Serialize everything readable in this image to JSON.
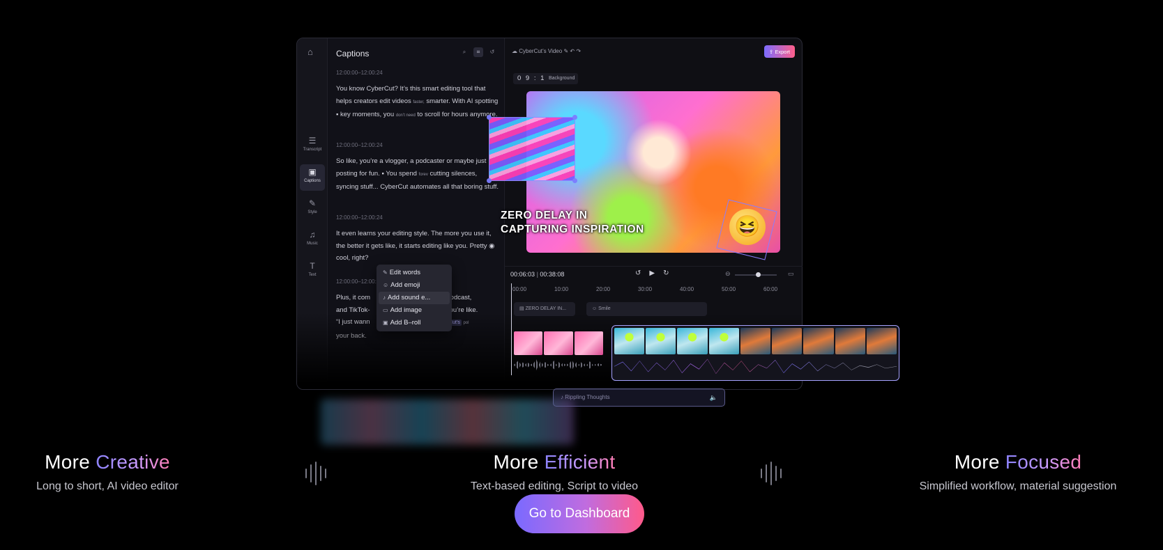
{
  "editor": {
    "captions_title": "Captions",
    "rail": {
      "transcript": "Transcript",
      "captions": "Captions",
      "style": "Style",
      "music": "Music",
      "text": "Text"
    },
    "segments": [
      {
        "time": "12:00:00–12:00:24"
      },
      {
        "time": "12:00:00–12:00:24"
      },
      {
        "time": "12:00:00–12:00:24"
      },
      {
        "time": "12:00:00–12:00:24"
      }
    ],
    "seg1": {
      "a": "You know CyberCut? It’s this smart editing tool that helps creators edit videos",
      "small1": "faster,",
      "b": "smarter. With AI spotting",
      "c": "key moments, you",
      "small2": "don’t need",
      "d": "to scroll for hours anymore."
    },
    "seg2": {
      "a": "So like, you’re a vlogger, a podcaster or maybe just posting for fun.",
      "b": "You spend",
      "small": "forev",
      "c": "cutting silences, syncing stuff... CyberCut automates all that boring stuff."
    },
    "seg3": {
      "a": "It even learns your editing style. The more you use it, the better it gets like, it starts editing like you. Pretty",
      "b": "cool, right?"
    },
    "seg4": {
      "a": "Plus, it com",
      "b": "podcast,",
      "c": "and TikTok-",
      "d": "you’re like.",
      "e": "“I just wann",
      "tag": "berCut’s",
      "small": "pol",
      "f": "your back."
    },
    "context_menu": [
      "Edit words",
      "Add emoji",
      "Add sound e...",
      "Add image",
      "Add B–roll"
    ],
    "project_name": "CyberCut’s Video",
    "export_label": "Export",
    "timecode": "0 9 : 16",
    "background_chip": "Background",
    "caption_overlay": [
      "ZERO DELAY IN",
      "CAPTURING INSPIRATION"
    ],
    "current_time": "00:06:03",
    "total_time": "00:38:08",
    "ruler": [
      "00:00",
      "10:00",
      "20:00",
      "30:00",
      "40:00",
      "50:00",
      "60:00"
    ],
    "track_chips": [
      "ZERO DELAY IN...",
      "Smile"
    ],
    "audio_track": "Rippling Thoughts"
  },
  "features": [
    {
      "lead": "More",
      "accent": "Creative",
      "desc": "Long to short, AI video editor"
    },
    {
      "lead": "More",
      "accent": "Efficient",
      "desc": "Text-based editing, Script to video"
    },
    {
      "lead": "More",
      "accent": "Focused",
      "desc": "Simplified workflow, material suggestion"
    }
  ],
  "cta_label": "Go to Dashboard",
  "colors": {
    "accent_start": "#7a6aff",
    "accent_end": "#ff5a8a",
    "background": "#000000"
  }
}
